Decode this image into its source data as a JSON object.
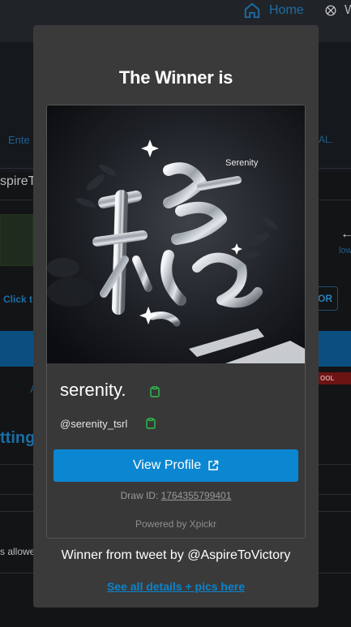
{
  "background": {
    "nav_home": "Home",
    "nav_other": "W",
    "partial_enter": "Ente",
    "partial_al": "AL.",
    "partial_aspire": "spireTo",
    "partial_click": "Click t",
    "partial_low": "low",
    "partial_or": "OR",
    "partial_a": "A",
    "partial_ool": "OOL FEATU",
    "partial_tting": "tting",
    "partial_allowed": "s allowe"
  },
  "modal": {
    "title": "The Winner is",
    "image_label": "Serenity",
    "winner_name": "serenity.",
    "winner_handle": "@serenity_tsrl",
    "view_profile_label": "View Profile",
    "draw_id_label": "Draw ID:",
    "draw_id": "1764355799401",
    "powered_by": "Powered by Xpickr",
    "winner_from": "Winner from tweet by @AspireToVictory",
    "details_link": "See all details + pics here"
  },
  "colors": {
    "accent": "#0b86d1",
    "link": "#0a84ce",
    "copy_icon": "#2fbf4f"
  },
  "icons": {
    "home": "home-icon",
    "other": "compass-icon",
    "copy": "clipboard-icon",
    "external": "external-link-icon",
    "sparkle": "sparkle-icon"
  }
}
